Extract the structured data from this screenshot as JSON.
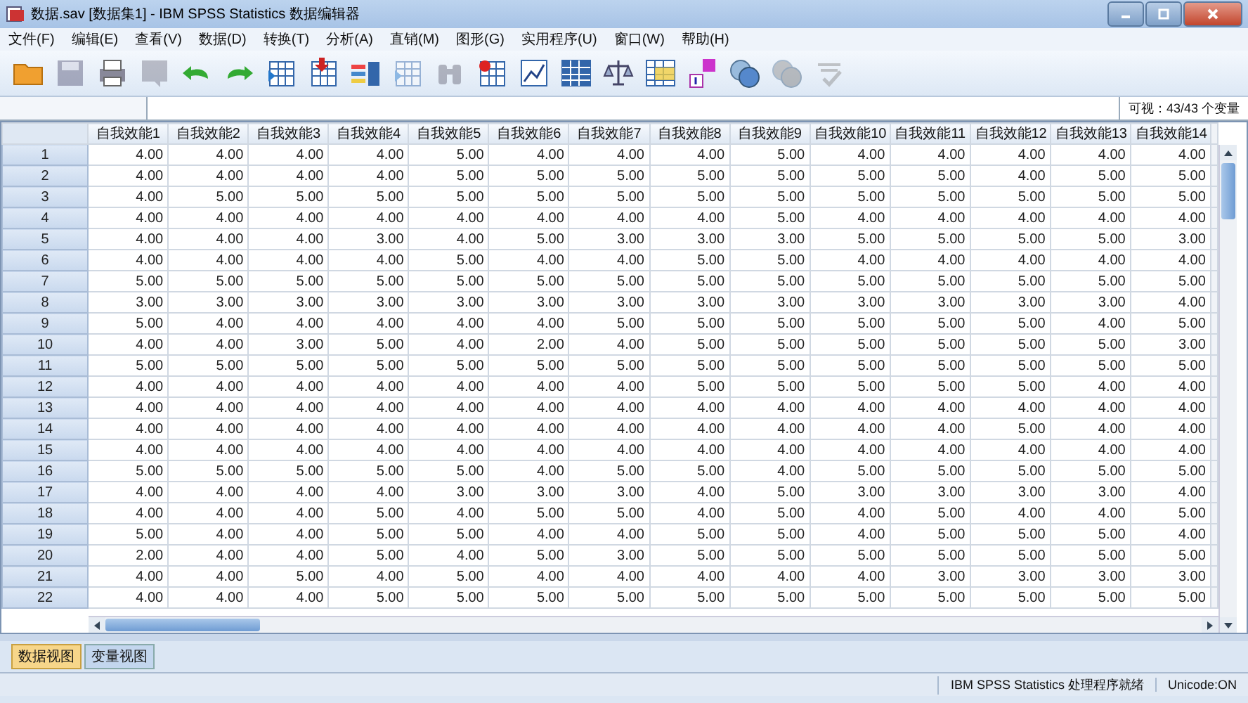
{
  "window": {
    "title": "数据.sav [数据集1] - IBM SPSS Statistics 数据编辑器"
  },
  "menu": [
    "文件(F)",
    "编辑(E)",
    "查看(V)",
    "数据(D)",
    "转换(T)",
    "分析(A)",
    "直销(M)",
    "图形(G)",
    "实用程序(U)",
    "窗口(W)",
    "帮助(H)"
  ],
  "toolbar": [
    {
      "kind": "folder",
      "disabled": false
    },
    {
      "kind": "disk",
      "disabled": true
    },
    {
      "kind": "printer",
      "disabled": false
    },
    {
      "kind": "dialog",
      "disabled": true
    },
    {
      "kind": "undo",
      "disabled": false
    },
    {
      "kind": "redo",
      "disabled": false
    },
    {
      "kind": "grid-arrow",
      "disabled": false
    },
    {
      "kind": "grid-down",
      "disabled": false
    },
    {
      "kind": "bars",
      "disabled": false
    },
    {
      "kind": "grid-arrow",
      "disabled": true
    },
    {
      "kind": "binoculars",
      "disabled": true
    },
    {
      "kind": "grid-star",
      "disabled": false
    },
    {
      "kind": "chart",
      "disabled": false
    },
    {
      "kind": "table",
      "disabled": false
    },
    {
      "kind": "scale",
      "disabled": false
    },
    {
      "kind": "table-yellow",
      "disabled": false
    },
    {
      "kind": "labels",
      "disabled": false
    },
    {
      "kind": "circles",
      "disabled": false
    },
    {
      "kind": "circles",
      "disabled": true
    },
    {
      "kind": "spell",
      "disabled": true
    }
  ],
  "visible_variables": "可视：43/43 个变量",
  "table": {
    "columns": [
      "自我效能1",
      "自我效能2",
      "自我效能3",
      "自我效能4",
      "自我效能5",
      "自我效能6",
      "自我效能7",
      "自我效能8",
      "自我效能9",
      "自我效能10",
      "自我效能11",
      "自我效能12",
      "自我效能13",
      "自我效能14"
    ],
    "rows": [
      {
        "n": "1",
        "cells": [
          "4.00",
          "4.00",
          "4.00",
          "4.00",
          "5.00",
          "4.00",
          "4.00",
          "4.00",
          "5.00",
          "4.00",
          "4.00",
          "4.00",
          "4.00",
          "4.00"
        ]
      },
      {
        "n": "2",
        "cells": [
          "4.00",
          "4.00",
          "4.00",
          "4.00",
          "5.00",
          "5.00",
          "5.00",
          "5.00",
          "5.00",
          "5.00",
          "5.00",
          "4.00",
          "5.00",
          "5.00"
        ]
      },
      {
        "n": "3",
        "cells": [
          "4.00",
          "5.00",
          "5.00",
          "5.00",
          "5.00",
          "5.00",
          "5.00",
          "5.00",
          "5.00",
          "5.00",
          "5.00",
          "5.00",
          "5.00",
          "5.00"
        ]
      },
      {
        "n": "4",
        "cells": [
          "4.00",
          "4.00",
          "4.00",
          "4.00",
          "4.00",
          "4.00",
          "4.00",
          "4.00",
          "5.00",
          "4.00",
          "4.00",
          "4.00",
          "4.00",
          "4.00"
        ]
      },
      {
        "n": "5",
        "cells": [
          "4.00",
          "4.00",
          "4.00",
          "3.00",
          "4.00",
          "5.00",
          "3.00",
          "3.00",
          "3.00",
          "5.00",
          "5.00",
          "5.00",
          "5.00",
          "3.00"
        ]
      },
      {
        "n": "6",
        "cells": [
          "4.00",
          "4.00",
          "4.00",
          "4.00",
          "5.00",
          "4.00",
          "4.00",
          "5.00",
          "5.00",
          "4.00",
          "4.00",
          "4.00",
          "4.00",
          "4.00"
        ]
      },
      {
        "n": "7",
        "cells": [
          "5.00",
          "5.00",
          "5.00",
          "5.00",
          "5.00",
          "5.00",
          "5.00",
          "5.00",
          "5.00",
          "5.00",
          "5.00",
          "5.00",
          "5.00",
          "5.00"
        ]
      },
      {
        "n": "8",
        "cells": [
          "3.00",
          "3.00",
          "3.00",
          "3.00",
          "3.00",
          "3.00",
          "3.00",
          "3.00",
          "3.00",
          "3.00",
          "3.00",
          "3.00",
          "3.00",
          "4.00"
        ]
      },
      {
        "n": "9",
        "cells": [
          "5.00",
          "4.00",
          "4.00",
          "4.00",
          "4.00",
          "4.00",
          "5.00",
          "5.00",
          "5.00",
          "5.00",
          "5.00",
          "5.00",
          "4.00",
          "5.00"
        ]
      },
      {
        "n": "10",
        "cells": [
          "4.00",
          "4.00",
          "3.00",
          "5.00",
          "4.00",
          "2.00",
          "4.00",
          "5.00",
          "5.00",
          "5.00",
          "5.00",
          "5.00",
          "5.00",
          "3.00"
        ]
      },
      {
        "n": "11",
        "cells": [
          "5.00",
          "5.00",
          "5.00",
          "5.00",
          "5.00",
          "5.00",
          "5.00",
          "5.00",
          "5.00",
          "5.00",
          "5.00",
          "5.00",
          "5.00",
          "5.00"
        ]
      },
      {
        "n": "12",
        "cells": [
          "4.00",
          "4.00",
          "4.00",
          "4.00",
          "4.00",
          "4.00",
          "4.00",
          "5.00",
          "5.00",
          "5.00",
          "5.00",
          "5.00",
          "4.00",
          "4.00"
        ]
      },
      {
        "n": "13",
        "cells": [
          "4.00",
          "4.00",
          "4.00",
          "4.00",
          "4.00",
          "4.00",
          "4.00",
          "4.00",
          "4.00",
          "4.00",
          "4.00",
          "4.00",
          "4.00",
          "4.00"
        ]
      },
      {
        "n": "14",
        "cells": [
          "4.00",
          "4.00",
          "4.00",
          "4.00",
          "4.00",
          "4.00",
          "4.00",
          "4.00",
          "4.00",
          "4.00",
          "4.00",
          "5.00",
          "4.00",
          "4.00"
        ]
      },
      {
        "n": "15",
        "cells": [
          "4.00",
          "4.00",
          "4.00",
          "4.00",
          "4.00",
          "4.00",
          "4.00",
          "4.00",
          "4.00",
          "4.00",
          "4.00",
          "4.00",
          "4.00",
          "4.00"
        ]
      },
      {
        "n": "16",
        "cells": [
          "5.00",
          "5.00",
          "5.00",
          "5.00",
          "5.00",
          "4.00",
          "5.00",
          "5.00",
          "4.00",
          "5.00",
          "5.00",
          "5.00",
          "5.00",
          "5.00"
        ]
      },
      {
        "n": "17",
        "cells": [
          "4.00",
          "4.00",
          "4.00",
          "4.00",
          "3.00",
          "3.00",
          "3.00",
          "4.00",
          "5.00",
          "3.00",
          "3.00",
          "3.00",
          "3.00",
          "4.00"
        ]
      },
      {
        "n": "18",
        "cells": [
          "4.00",
          "4.00",
          "4.00",
          "5.00",
          "4.00",
          "5.00",
          "5.00",
          "4.00",
          "5.00",
          "4.00",
          "5.00",
          "4.00",
          "4.00",
          "5.00"
        ]
      },
      {
        "n": "19",
        "cells": [
          "5.00",
          "4.00",
          "4.00",
          "5.00",
          "5.00",
          "4.00",
          "4.00",
          "5.00",
          "5.00",
          "4.00",
          "5.00",
          "5.00",
          "5.00",
          "4.00"
        ]
      },
      {
        "n": "20",
        "cells": [
          "2.00",
          "4.00",
          "4.00",
          "5.00",
          "4.00",
          "5.00",
          "3.00",
          "5.00",
          "5.00",
          "5.00",
          "5.00",
          "5.00",
          "5.00",
          "5.00"
        ]
      },
      {
        "n": "21",
        "cells": [
          "4.00",
          "4.00",
          "5.00",
          "4.00",
          "5.00",
          "4.00",
          "4.00",
          "4.00",
          "4.00",
          "4.00",
          "3.00",
          "3.00",
          "3.00",
          "3.00"
        ]
      },
      {
        "n": "22",
        "cells": [
          "4.00",
          "4.00",
          "4.00",
          "5.00",
          "5.00",
          "5.00",
          "5.00",
          "5.00",
          "5.00",
          "5.00",
          "5.00",
          "5.00",
          "5.00",
          "5.00"
        ]
      }
    ]
  },
  "tabs": [
    {
      "label": "数据视图",
      "selected": true
    },
    {
      "label": "变量视图",
      "selected": false
    }
  ],
  "status_bar": [
    "IBM SPSS Statistics 处理程序就绪",
    "Unicode:ON"
  ]
}
